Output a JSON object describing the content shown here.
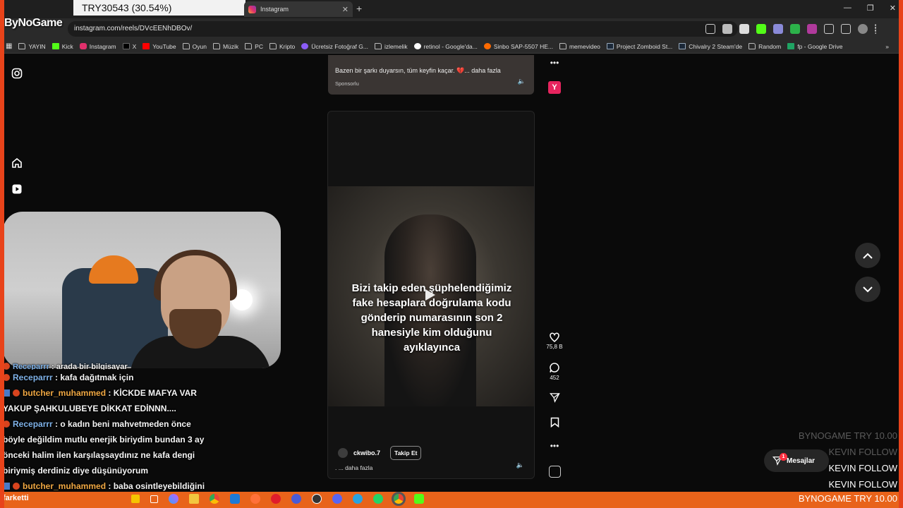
{
  "stream": {
    "ticker_tab": "TRY30543 (30.54%)",
    "logo": "ByNoGame"
  },
  "browser": {
    "tab_title": "Instagram",
    "url": "instagram.com/reels/DVcEENhDBOv/",
    "bookmarks": [
      "YAYIN",
      "Kick",
      "Instagram",
      "X",
      "YouTube",
      "Oyun",
      "Müzik",
      "PC",
      "Kripto",
      "Ücretsiz Fotoğraf G...",
      "izlemelik",
      "retinol - Google'da...",
      "Sinbo SAP-5507 HE...",
      "memevideo",
      "Project Zomboid St...",
      "Chivalry 2 Steam'de",
      "Random",
      "fp - Google Drive"
    ]
  },
  "reel_top": {
    "text": "Bazen bir şarkı duyarsın, tüm keyfin kaçar. 💔... daha fazla",
    "sponsored": "Sponsorlu"
  },
  "reel": {
    "caption": "Bizi takip eden şüphelendiğimiz fake hesaplara doğrulama kodu gönderip numarasının son 2 hanesiyle kim olduğunu ayıklayınca",
    "username": "ckwibo.7",
    "follow_label": "Takip Et",
    "more": ". ... daha fazla",
    "likes": "75,8 B",
    "comments": "452"
  },
  "side_badge": {
    "letter": "Y",
    "color": "#e6245e"
  },
  "messages": {
    "label": "Mesajlar",
    "count": "1"
  },
  "chat": [
    {
      "user": "Receparrr",
      "text": ": arada bir bilgisayar",
      "color": "#7fb2e8"
    },
    {
      "user": "Receparrr",
      "text": ": kafa dağıtmak için",
      "color": "#7fb2e8"
    },
    {
      "user": "butcher_muhammed",
      "text": ": KİCKDE MAFYA VAR YAKUP ŞAHKULUBEYE DİKKAT EDİNNN....",
      "color": "#f0a843"
    },
    {
      "user": "Receparrr",
      "text": ": o kadın beni mahvetmeden önce böyle değildim mutlu enerjik biriydim bundan 3 ay önceki halim ilen karşılaşsaydınız ne kafa dengi biriymiş derdiniz diye düşünüyorum",
      "color": "#7fb2e8"
    },
    {
      "user": "butcher_muhammed",
      "text": ": baba osintleyebildiğini",
      "color": "#f0a843"
    }
  ],
  "chat_footer": "farketti",
  "alerts": {
    "faded": [
      "BYNOGAME  TRY 10.00",
      "KEVIN  FOLLOW"
    ],
    "bright": [
      "KEVIN  FOLLOW",
      "KEVIN  FOLLOW"
    ],
    "bottom": "BYNOGAME  TRY 10.00"
  },
  "colors": {
    "frame": "#e8431a",
    "accent_like": "#ff3040"
  }
}
